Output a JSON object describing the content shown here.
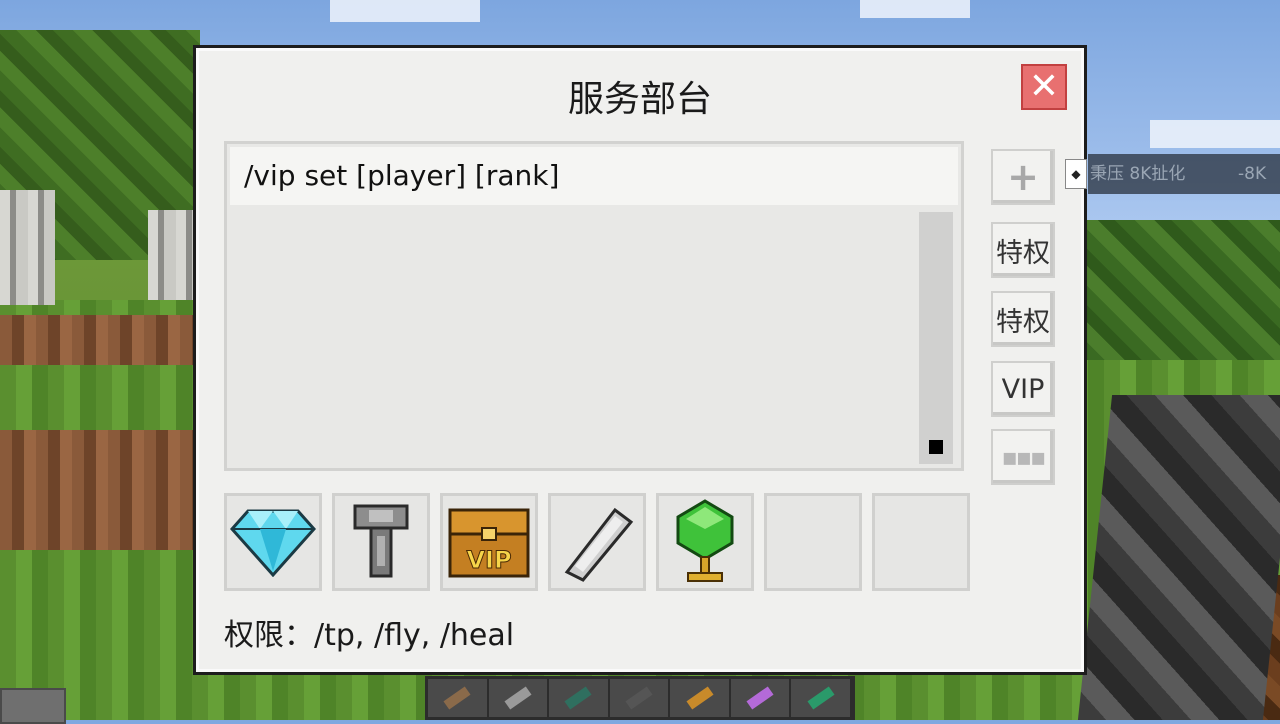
{
  "dialog": {
    "title": "服务部台",
    "close_icon": "close-icon",
    "command": "/vip set [player] [rank]",
    "side_buttons": [
      {
        "name": "add",
        "label": "+"
      },
      {
        "name": "privilege-1",
        "label": "特权"
      },
      {
        "name": "privilege-2",
        "label": "特权"
      },
      {
        "name": "vip",
        "label": "VIP"
      },
      {
        "name": "grid",
        "label": "▪▪▪"
      }
    ],
    "items": [
      {
        "icon": "diamond-icon"
      },
      {
        "icon": "iron-key-icon"
      },
      {
        "icon": "vip-chest-icon",
        "text": "VIP"
      },
      {
        "icon": "iron-ingot-icon"
      },
      {
        "icon": "emerald-trophy-icon"
      },
      {
        "icon": "empty-slot"
      },
      {
        "icon": "empty-slot"
      }
    ],
    "permissions": "权限：/tp, /fly, /heal"
  },
  "background": {
    "overlay_text_a": "秉压 8K扯化",
    "overlay_text_b": "-8K"
  },
  "colors": {
    "close_button": "#e87070",
    "panel": "#f0f0ee"
  }
}
